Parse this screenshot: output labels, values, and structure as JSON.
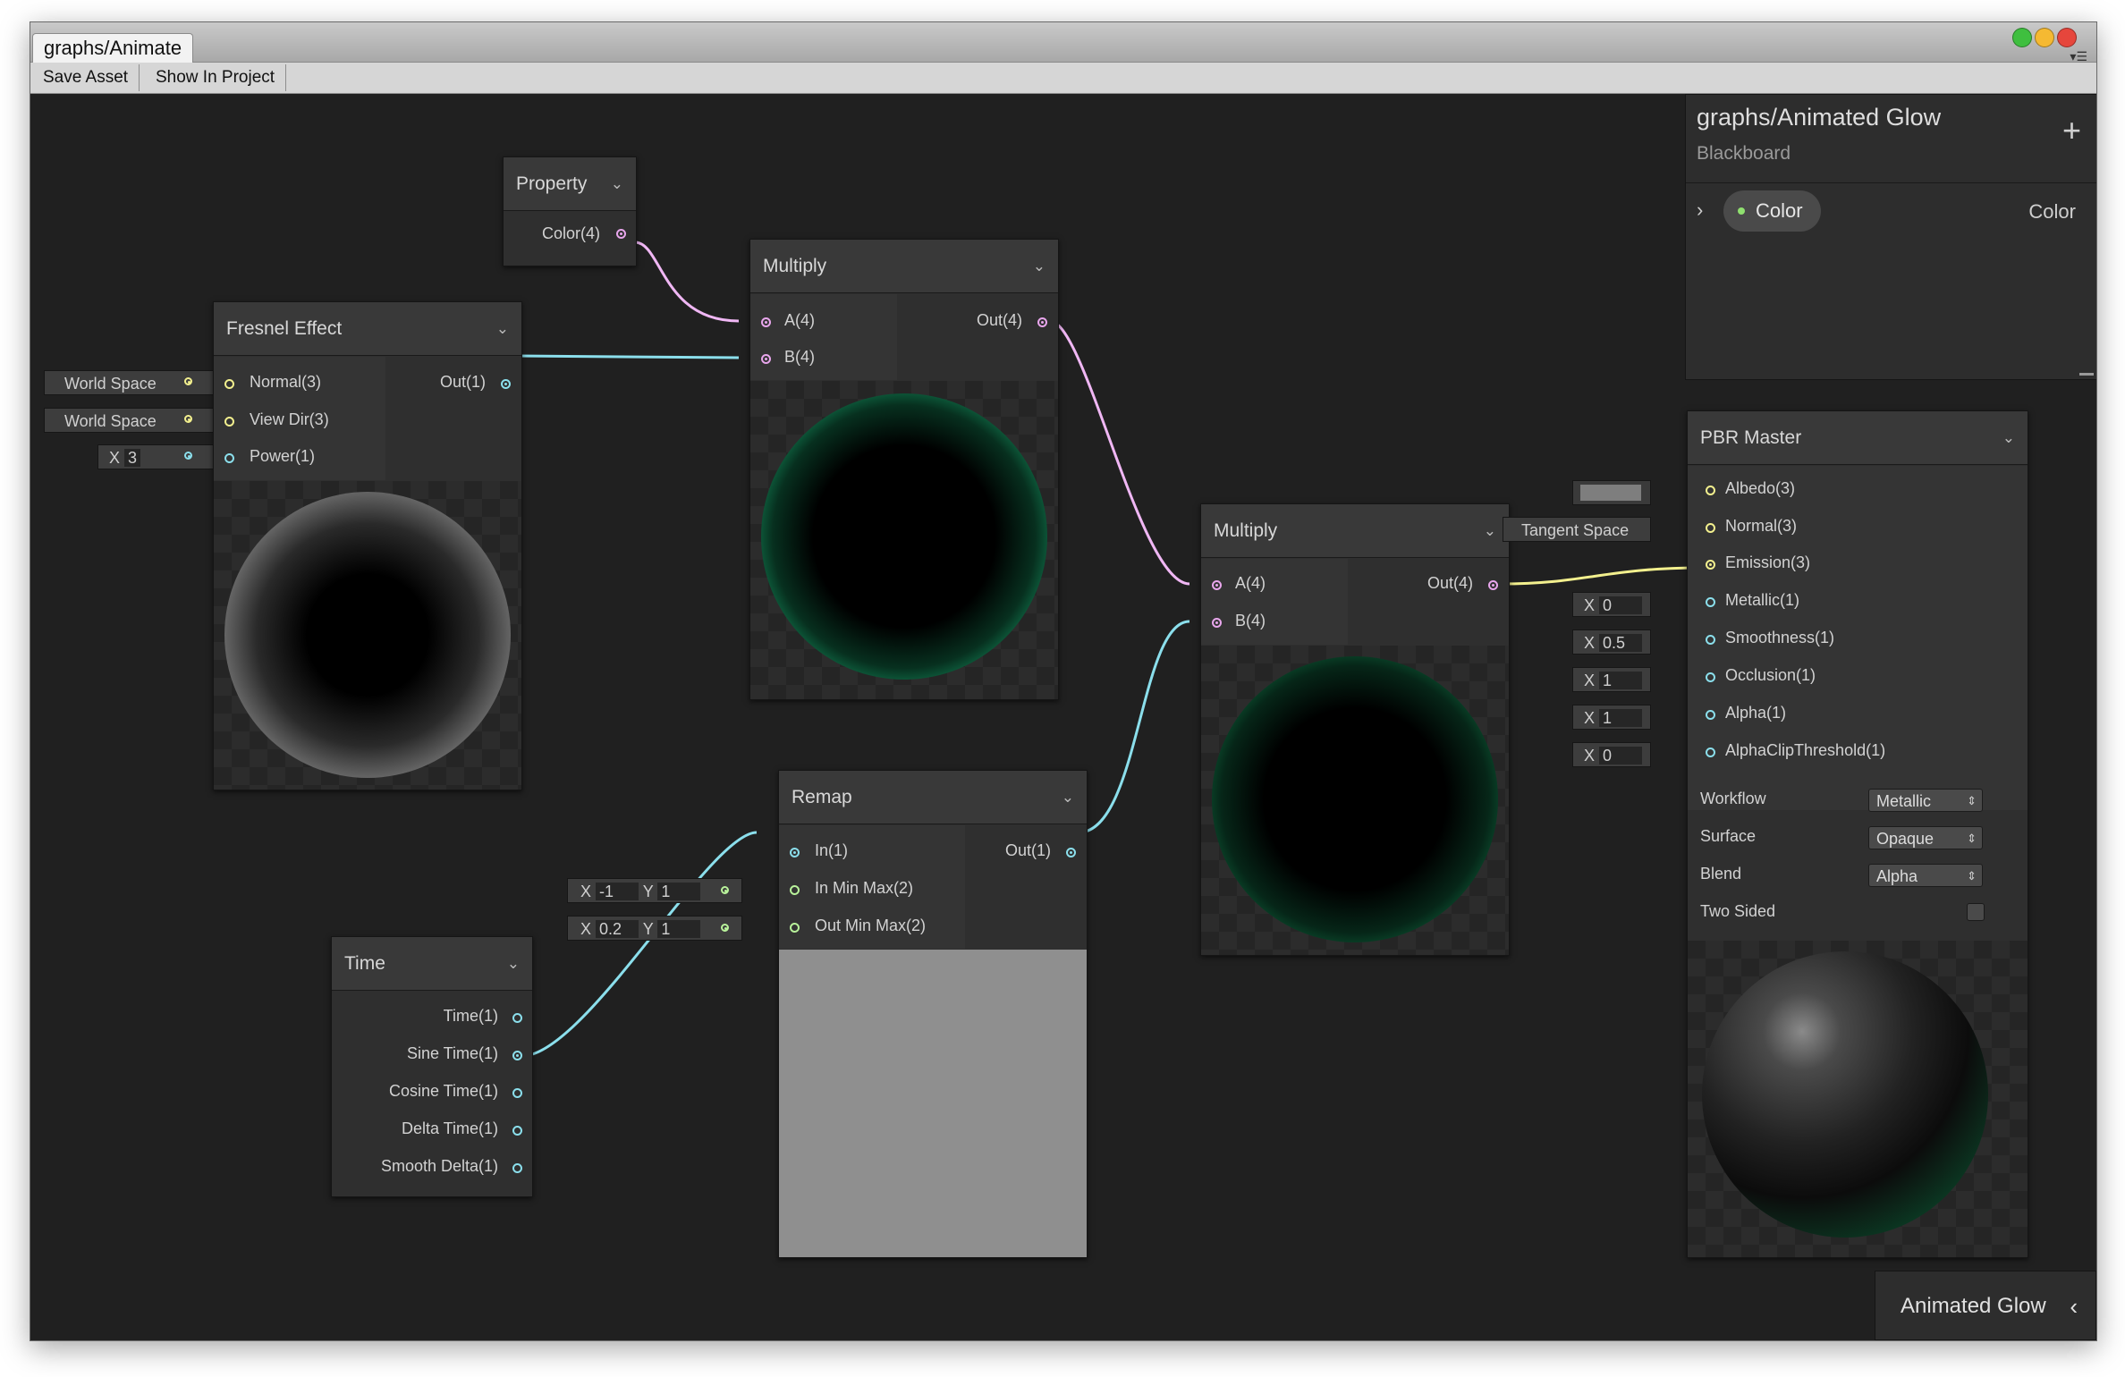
{
  "window": {
    "tab_title": "graphs/Animate",
    "toolbar": {
      "save_asset": "Save Asset",
      "show_in_project": "Show In Project"
    },
    "traffic_lights": {
      "green": "#3fbf3f",
      "yellow": "#f5b932",
      "red": "#e6463c"
    }
  },
  "colors": {
    "canvas": "#202020",
    "wire_color4": "#f0b7f4",
    "wire_vector3": "#f3f08e",
    "wire_vector1": "#8bdfec",
    "emission_green": "#2fe79c"
  },
  "nodes": {
    "property": {
      "title": "Property",
      "output": "Color(4)"
    },
    "fresnel": {
      "title": "Fresnel Effect",
      "inputs": [
        "Normal(3)",
        "View Dir(3)",
        "Power(1)"
      ],
      "output": "Out(1)",
      "defaults": {
        "normal": "World Space",
        "view_dir": "World Space",
        "power_x_label": "X",
        "power_value": "3"
      }
    },
    "multiply1": {
      "title": "Multiply",
      "inputs": [
        "A(4)",
        "B(4)"
      ],
      "output": "Out(4)"
    },
    "multiply2": {
      "title": "Multiply",
      "inputs": [
        "A(4)",
        "B(4)"
      ],
      "output": "Out(4)"
    },
    "remap": {
      "title": "Remap",
      "inputs": [
        "In(1)",
        "In Min Max(2)",
        "Out Min Max(2)"
      ],
      "output": "Out(1)",
      "in_min_max": {
        "x_label": "X",
        "x": "-1",
        "y_label": "Y",
        "y": "1"
      },
      "out_min_max": {
        "x_label": "X",
        "x": "0.2",
        "y_label": "Y",
        "y": "1"
      }
    },
    "time": {
      "title": "Time",
      "outputs": [
        "Time(1)",
        "Sine Time(1)",
        "Cosine Time(1)",
        "Delta Time(1)",
        "Smooth Delta(1)"
      ]
    },
    "pbr_master": {
      "title": "PBR Master",
      "inputs": [
        "Albedo(3)",
        "Normal(3)",
        "Emission(3)",
        "Metallic(1)",
        "Smoothness(1)",
        "Occlusion(1)",
        "Alpha(1)",
        "AlphaClipThreshold(1)"
      ],
      "defaults": {
        "normal": "Tangent Space",
        "x_label": "X",
        "metallic": "0",
        "smoothness": "0.5",
        "occlusion": "1",
        "alpha": "1",
        "alpha_clip": "0"
      },
      "settings": {
        "workflow_label": "Workflow",
        "workflow": "Metallic",
        "surface_label": "Surface",
        "surface": "Opaque",
        "blend_label": "Blend",
        "blend": "Alpha",
        "two_sided_label": "Two Sided",
        "two_sided": false
      }
    }
  },
  "blackboard": {
    "title": "graphs/Animated Glow",
    "subtitle": "Blackboard",
    "add_icon": "plus-icon",
    "property_name": "Color",
    "property_type": "Color"
  },
  "footer_tab": {
    "label": "Animated Glow"
  }
}
